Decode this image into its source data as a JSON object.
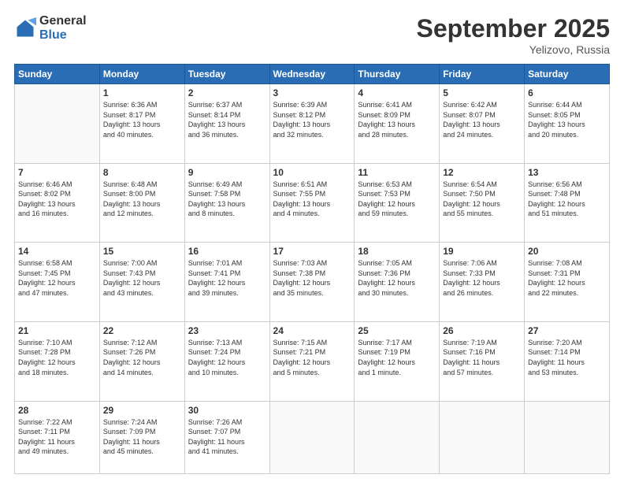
{
  "logo": {
    "general": "General",
    "blue": "Blue"
  },
  "header": {
    "month": "September 2025",
    "location": "Yelizovo, Russia"
  },
  "weekdays": [
    "Sunday",
    "Monday",
    "Tuesday",
    "Wednesday",
    "Thursday",
    "Friday",
    "Saturday"
  ],
  "weeks": [
    [
      {
        "day": "",
        "info": ""
      },
      {
        "day": "1",
        "info": "Sunrise: 6:36 AM\nSunset: 8:17 PM\nDaylight: 13 hours\nand 40 minutes."
      },
      {
        "day": "2",
        "info": "Sunrise: 6:37 AM\nSunset: 8:14 PM\nDaylight: 13 hours\nand 36 minutes."
      },
      {
        "day": "3",
        "info": "Sunrise: 6:39 AM\nSunset: 8:12 PM\nDaylight: 13 hours\nand 32 minutes."
      },
      {
        "day": "4",
        "info": "Sunrise: 6:41 AM\nSunset: 8:09 PM\nDaylight: 13 hours\nand 28 minutes."
      },
      {
        "day": "5",
        "info": "Sunrise: 6:42 AM\nSunset: 8:07 PM\nDaylight: 13 hours\nand 24 minutes."
      },
      {
        "day": "6",
        "info": "Sunrise: 6:44 AM\nSunset: 8:05 PM\nDaylight: 13 hours\nand 20 minutes."
      }
    ],
    [
      {
        "day": "7",
        "info": "Sunrise: 6:46 AM\nSunset: 8:02 PM\nDaylight: 13 hours\nand 16 minutes."
      },
      {
        "day": "8",
        "info": "Sunrise: 6:48 AM\nSunset: 8:00 PM\nDaylight: 13 hours\nand 12 minutes."
      },
      {
        "day": "9",
        "info": "Sunrise: 6:49 AM\nSunset: 7:58 PM\nDaylight: 13 hours\nand 8 minutes."
      },
      {
        "day": "10",
        "info": "Sunrise: 6:51 AM\nSunset: 7:55 PM\nDaylight: 13 hours\nand 4 minutes."
      },
      {
        "day": "11",
        "info": "Sunrise: 6:53 AM\nSunset: 7:53 PM\nDaylight: 12 hours\nand 59 minutes."
      },
      {
        "day": "12",
        "info": "Sunrise: 6:54 AM\nSunset: 7:50 PM\nDaylight: 12 hours\nand 55 minutes."
      },
      {
        "day": "13",
        "info": "Sunrise: 6:56 AM\nSunset: 7:48 PM\nDaylight: 12 hours\nand 51 minutes."
      }
    ],
    [
      {
        "day": "14",
        "info": "Sunrise: 6:58 AM\nSunset: 7:45 PM\nDaylight: 12 hours\nand 47 minutes."
      },
      {
        "day": "15",
        "info": "Sunrise: 7:00 AM\nSunset: 7:43 PM\nDaylight: 12 hours\nand 43 minutes."
      },
      {
        "day": "16",
        "info": "Sunrise: 7:01 AM\nSunset: 7:41 PM\nDaylight: 12 hours\nand 39 minutes."
      },
      {
        "day": "17",
        "info": "Sunrise: 7:03 AM\nSunset: 7:38 PM\nDaylight: 12 hours\nand 35 minutes."
      },
      {
        "day": "18",
        "info": "Sunrise: 7:05 AM\nSunset: 7:36 PM\nDaylight: 12 hours\nand 30 minutes."
      },
      {
        "day": "19",
        "info": "Sunrise: 7:06 AM\nSunset: 7:33 PM\nDaylight: 12 hours\nand 26 minutes."
      },
      {
        "day": "20",
        "info": "Sunrise: 7:08 AM\nSunset: 7:31 PM\nDaylight: 12 hours\nand 22 minutes."
      }
    ],
    [
      {
        "day": "21",
        "info": "Sunrise: 7:10 AM\nSunset: 7:28 PM\nDaylight: 12 hours\nand 18 minutes."
      },
      {
        "day": "22",
        "info": "Sunrise: 7:12 AM\nSunset: 7:26 PM\nDaylight: 12 hours\nand 14 minutes."
      },
      {
        "day": "23",
        "info": "Sunrise: 7:13 AM\nSunset: 7:24 PM\nDaylight: 12 hours\nand 10 minutes."
      },
      {
        "day": "24",
        "info": "Sunrise: 7:15 AM\nSunset: 7:21 PM\nDaylight: 12 hours\nand 5 minutes."
      },
      {
        "day": "25",
        "info": "Sunrise: 7:17 AM\nSunset: 7:19 PM\nDaylight: 12 hours\nand 1 minute."
      },
      {
        "day": "26",
        "info": "Sunrise: 7:19 AM\nSunset: 7:16 PM\nDaylight: 11 hours\nand 57 minutes."
      },
      {
        "day": "27",
        "info": "Sunrise: 7:20 AM\nSunset: 7:14 PM\nDaylight: 11 hours\nand 53 minutes."
      }
    ],
    [
      {
        "day": "28",
        "info": "Sunrise: 7:22 AM\nSunset: 7:11 PM\nDaylight: 11 hours\nand 49 minutes."
      },
      {
        "day": "29",
        "info": "Sunrise: 7:24 AM\nSunset: 7:09 PM\nDaylight: 11 hours\nand 45 minutes."
      },
      {
        "day": "30",
        "info": "Sunrise: 7:26 AM\nSunset: 7:07 PM\nDaylight: 11 hours\nand 41 minutes."
      },
      {
        "day": "",
        "info": ""
      },
      {
        "day": "",
        "info": ""
      },
      {
        "day": "",
        "info": ""
      },
      {
        "day": "",
        "info": ""
      }
    ]
  ]
}
